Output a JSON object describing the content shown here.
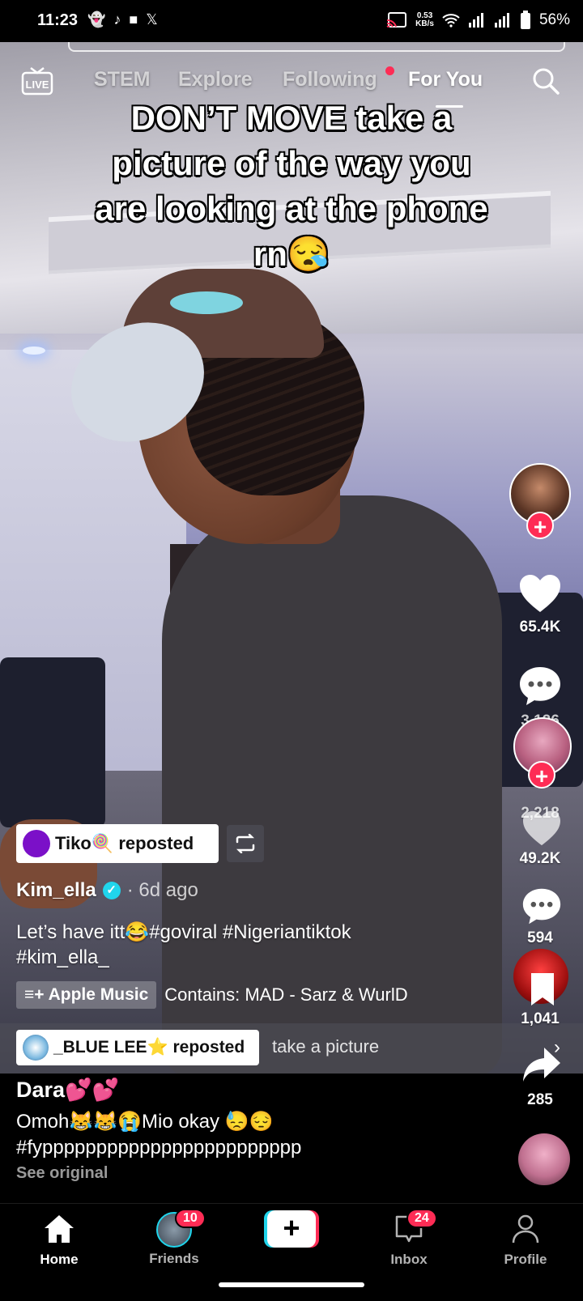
{
  "status_bar": {
    "time": "11:23",
    "net_speed_value": "0.53",
    "net_speed_unit": "KB/s",
    "battery": "56%"
  },
  "top_nav": {
    "live_label": "LIVE",
    "tabs": [
      "STEM",
      "Explore",
      "Following",
      "For You"
    ],
    "active_tab": "For You"
  },
  "video": {
    "overlay_text_lines": [
      "DON’T MOVE take a",
      "picture of the way you",
      "are looking at the phone",
      "rn😪"
    ]
  },
  "rail": {
    "likes": "65.4K",
    "comments": "3,126",
    "saves": "2,218",
    "likes2": "49.2K",
    "comments2": "594",
    "saves2": "1,041",
    "shares": "285"
  },
  "post": {
    "reposter": "Tiko🍭 reposted",
    "author": "Kim_ella",
    "time_ago": "· 6d ago",
    "description_line1": "Let’s have itt😂#goviral #Nigeriantiktok",
    "description_line2": "#kim_ella_",
    "music_app": "Apple Music",
    "music_text": "Contains: MAD - Sarz & WurlD"
  },
  "next_post": {
    "reposter": "_BLUE LEE⭐ reposted",
    "peek_text": "take a picture",
    "title": "Dara💕💕",
    "body_line1": "Omoh😹😹😭Mio okay 😓😔",
    "body_line2": "#fypppppppppppppppppppppppp",
    "see_original": "See original"
  },
  "bottom_nav": {
    "items": [
      "Home",
      "Friends",
      "",
      "Inbox",
      "Profile"
    ],
    "friends_badge": "10",
    "inbox_badge": "24"
  },
  "colors": {
    "accent": "#fe2c55",
    "verified": "#20d5ec"
  }
}
